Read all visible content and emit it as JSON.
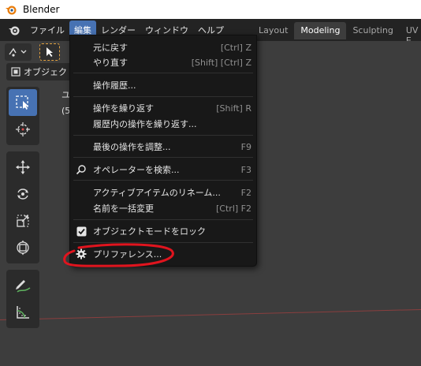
{
  "window": {
    "title": "Blender"
  },
  "menubar": {
    "items": [
      "ファイル",
      "編集",
      "レンダー",
      "ウィンドウ",
      "ヘルプ"
    ],
    "active_index": 1
  },
  "workspace_tabs": [
    "Layout",
    "Modeling",
    "Sculpting",
    "UV E"
  ],
  "active_workspace": "Modeling",
  "viewport": {
    "mode_label": "オブジェクト",
    "overlay_line1": "ユ",
    "overlay_line2": "(5"
  },
  "edit_menu": {
    "items": [
      {
        "label": "元に戻す",
        "shortcut": "[Ctrl] Z",
        "icon": ""
      },
      {
        "label": "やり直す",
        "shortcut": "[Shift] [Ctrl] Z",
        "icon": ""
      },
      {
        "label": "操作履歴...",
        "shortcut": "",
        "icon": ""
      },
      {
        "label": "操作を繰り返す",
        "shortcut": "[Shift] R",
        "icon": ""
      },
      {
        "label": "履歴内の操作を繰り返す...",
        "shortcut": "",
        "icon": ""
      },
      {
        "label": "最後の操作を調整...",
        "shortcut": "F9",
        "icon": ""
      },
      {
        "label": "オペレーターを検索...",
        "shortcut": "F3",
        "icon": "search-icon"
      },
      {
        "label": "アクティブアイテムのリネーム...",
        "shortcut": "F2",
        "icon": ""
      },
      {
        "label": "名前を一括変更",
        "shortcut": "[Ctrl] F2",
        "icon": ""
      },
      {
        "label": "オブジェクトモードをロック",
        "shortcut": "",
        "icon": "checkbox-checked-icon"
      },
      {
        "label": "プリファレンス...",
        "shortcut": "",
        "icon": "gear-icon"
      }
    ]
  },
  "colors": {
    "accent": "#4772b3",
    "menu_bg": "#181818",
    "viewport_bg": "#3d3d3d",
    "annotation_red": "#e0141e"
  }
}
